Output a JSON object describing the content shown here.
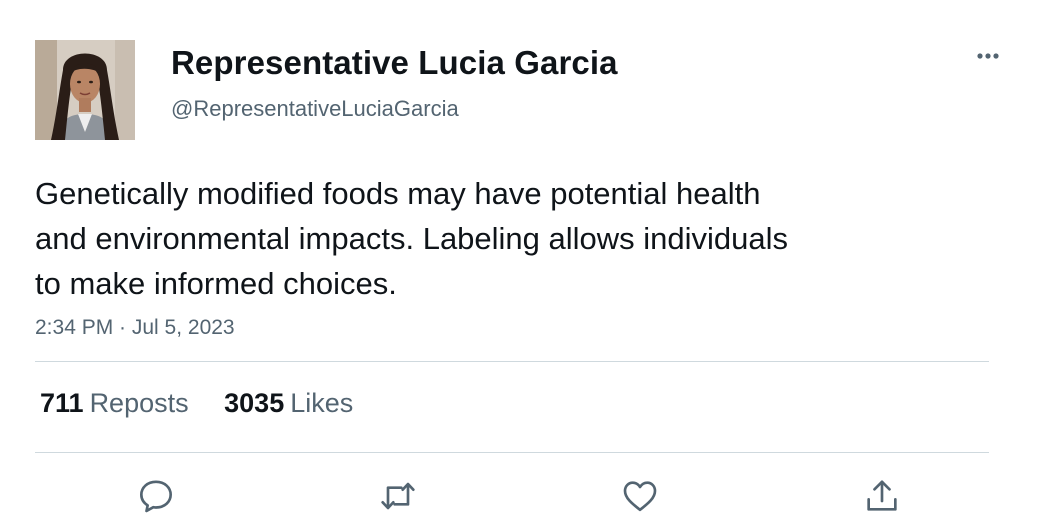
{
  "tweet": {
    "author": {
      "display_name": "Representative Lucia Garcia",
      "handle": "@RepresentativeLuciaGarcia"
    },
    "text": "Genetically modified foods may have potential health\nand environmental impacts. Labeling allows individuals\nto make informed choices.",
    "timestamp": "2:34 PM · Jul 5, 2023",
    "stats": {
      "reposts_count": "711",
      "reposts_label": "Reposts",
      "likes_count": "3035",
      "likes_label": "Likes"
    }
  },
  "icons": {
    "more": "more-horizontal-icon",
    "reply": "reply-icon",
    "repost": "repost-icon",
    "like": "heart-icon",
    "share": "share-icon"
  },
  "colors": {
    "primary_text": "#0f1419",
    "secondary_text": "#536471",
    "divider": "#cfd9de"
  }
}
